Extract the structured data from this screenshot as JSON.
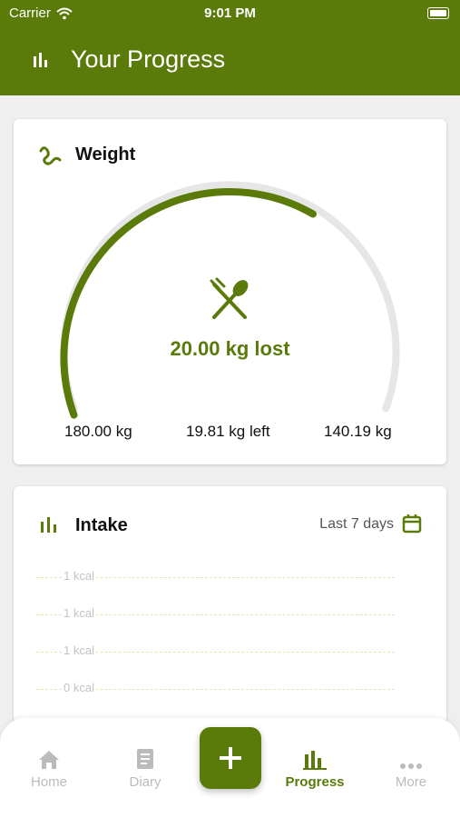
{
  "status_bar": {
    "carrier": "Carrier",
    "time": "9:01 PM"
  },
  "app_bar": {
    "title": "Your Progress"
  },
  "weight_card": {
    "title": "Weight",
    "lost_text": "20.00 kg lost",
    "start_label": "180.00 kg",
    "left_label": "19.81 kg left",
    "goal_label": "140.19 kg",
    "progress_fraction": 0.5,
    "accent_color": "#5a7a0a",
    "track_color": "#e6e6e6"
  },
  "intake_card": {
    "title": "Intake",
    "range_label": "Last 7 days",
    "grid_labels": [
      "1 kcal",
      "1 kcal",
      "1 kcal",
      "0 kcal"
    ]
  },
  "tab_bar": {
    "tabs": [
      {
        "label": "Home",
        "icon": "home-icon"
      },
      {
        "label": "Diary",
        "icon": "diary-icon"
      },
      {
        "label": "Progress",
        "icon": "bar-chart-icon",
        "active": true
      },
      {
        "label": "More",
        "icon": "more-dots-icon"
      }
    ],
    "add_icon": "plus-icon"
  }
}
